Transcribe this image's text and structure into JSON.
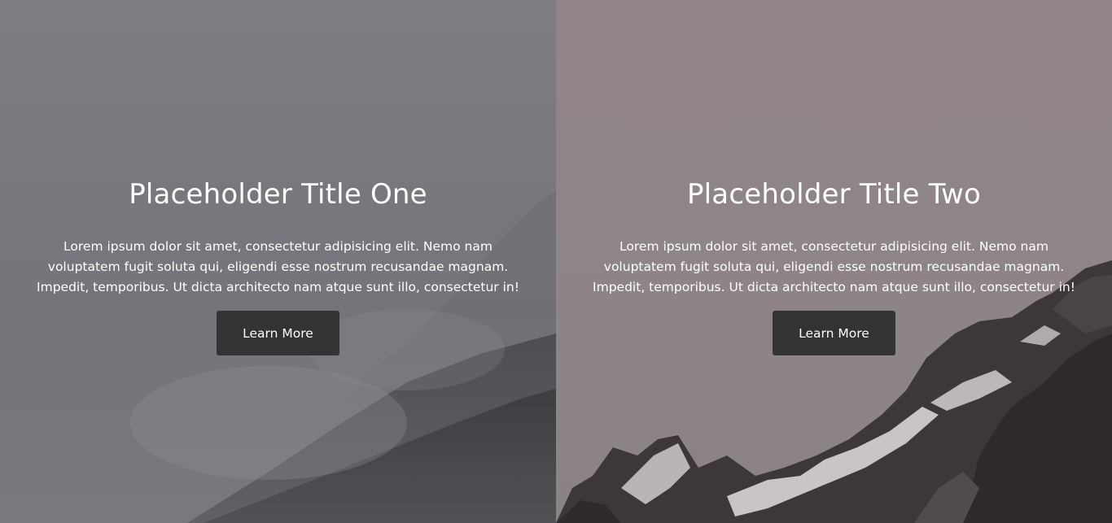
{
  "panels": [
    {
      "title": "Placeholder Title One",
      "body": "Lorem ipsum dolor sit amet, consectetur adipisicing elit. Nemo nam voluptatem fugit soluta qui, eligendi esse nostrum recusandae magnam. Impedit, temporibus. Ut dicta architecto nam atque sunt illo, consectetur in!",
      "button_label": "Learn More",
      "background": "misty mountain slope"
    },
    {
      "title": "Placeholder Title Two",
      "body": "Lorem ipsum dolor sit amet, consectetur adipisicing elit. Nemo nam voluptatem fugit soluta qui, eligendi esse nostrum recusandae magnam. Impedit, temporibus. Ut dicta architecto nam atque sunt illo, consectetur in!",
      "button_label": "Learn More",
      "background": "snowy rocky mountain ridge"
    }
  ],
  "colors": {
    "button_bg": "#333333",
    "text": "#ffffff",
    "left_overlay": "#76767c",
    "right_overlay": "#8f8586"
  }
}
